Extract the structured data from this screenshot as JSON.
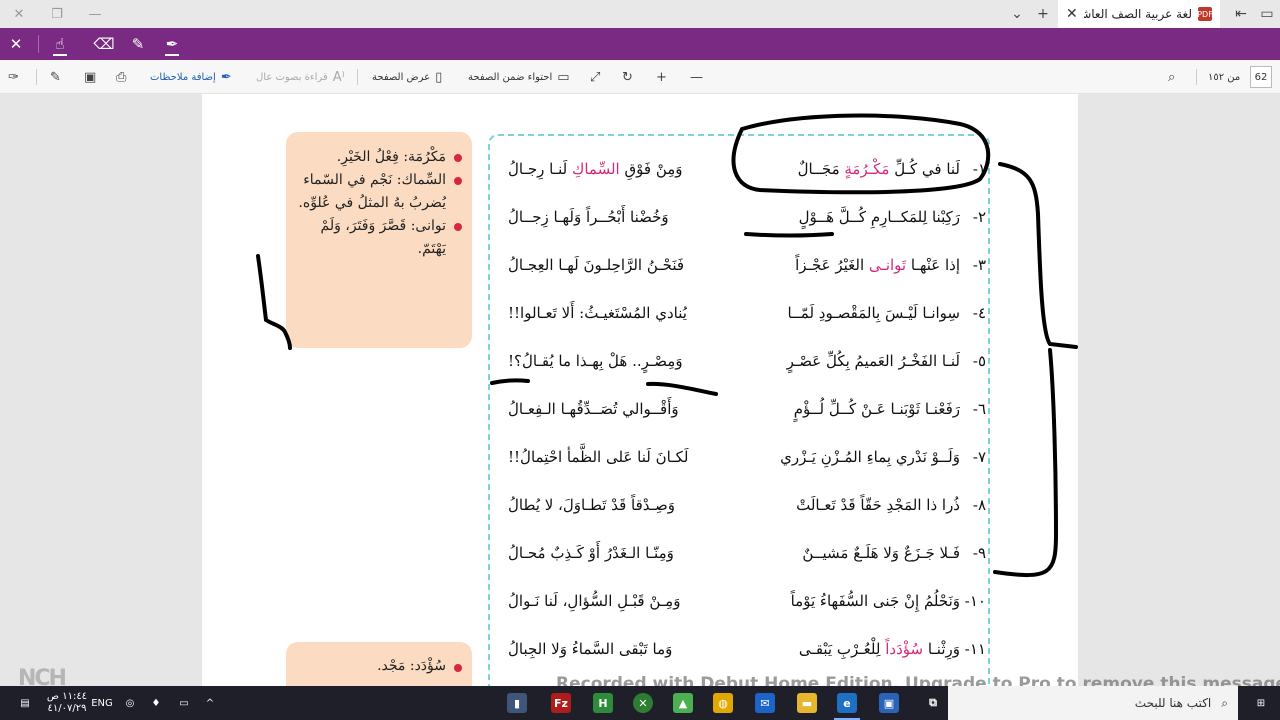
{
  "browser": {
    "tab_title": "لغة عربية الصف العاشر ا",
    "tab_badge": "PDF"
  },
  "reading_toolbar": {
    "page_number": "62",
    "page_total": "من ١٥٢",
    "fit_page": "احتواء ضمن الصفحة",
    "page_view": "عرض الصفحة",
    "read_aloud": "قراءة بصوت عال",
    "add_notes": "إضافة ملاحظات"
  },
  "poem": {
    "verses": [
      {
        "num": "١-",
        "h1_a": "لَنا في كُـلِّ ",
        "h1_pink": "مَكْـرُمَةٍ",
        "h1_b": " مَجَــالٌ",
        "h2_a": "وَمِنْ فَوْقِ ",
        "h2_pink": "السِّماكِ",
        "h2_b": " لَنـا رِجـالُ"
      },
      {
        "num": "٢-",
        "h1_a": "رَكِبْنا لِلمَكــارِمِ كُــلَّ هَــوْلٍ",
        "h1_pink": "",
        "h1_b": "",
        "h2_a": "وَخُضْنا أَبْحُــراً وَلَهـا زِجــالُ",
        "h2_pink": "",
        "h2_b": ""
      },
      {
        "num": "٣-",
        "h1_a": "إذا عَنْهـا ",
        "h1_pink": "تَوانـى",
        "h1_b": " الغَيْرُ عَجْـزاً",
        "h2_a": "فَنَحْـنُ الرَّاحِلـونَ لَهـا العِجـالُ",
        "h2_pink": "",
        "h2_b": ""
      },
      {
        "num": "٤-",
        "h1_a": "سِوانـا لَيْـسَ بِالمَقْصـودِ لَمّــا",
        "h1_pink": "",
        "h1_b": "",
        "h2_a": "يُنادي المُسْتَغيـثُ: أَلا تَعـالوا!!",
        "h2_pink": "",
        "h2_b": ""
      },
      {
        "num": "٥-",
        "h1_a": "لَنـا الفَخْـرُ العَميمُ بِكُلِّ عَصْـرٍ",
        "h1_pink": "",
        "h1_b": "",
        "h2_a": "وَمِصْـرٍ.. هَلْ بِهـذا ما يُقـالُ؟!",
        "h2_pink": "",
        "h2_b": ""
      },
      {
        "num": "٦-",
        "h1_a": "رَفَعْنـا ثَوْبَنـا عَـنْ كُــلِّ لُــؤْمٍ",
        "h1_pink": "",
        "h1_b": "",
        "h2_a": "وَأَقْــوالي تُصَــدِّقُهـا الـفِعـالُ",
        "h2_pink": "",
        "h2_b": ""
      },
      {
        "num": "٧-",
        "h1_a": "وَلَــوْ نَدْري بِماءِ المُـزْنِ يَـزْري",
        "h1_pink": "",
        "h1_b": "",
        "h2_a": "لَكـانَ لَنا عَلى الظَّمأ احْتِمالُ!!",
        "h2_pink": "",
        "h2_b": ""
      },
      {
        "num": "٨-",
        "h1_a": "ذُرا ذا المَجْدِ حَقّاً قَدْ تَعـالَتْ",
        "h1_pink": "",
        "h1_b": "",
        "h2_a": "وَصِـدْقاً قَدْ تَطـاوَلَ، لا يُطالُ",
        "h2_pink": "",
        "h2_b": ""
      },
      {
        "num": "٩-",
        "h1_a": "فَـلا جَـزَعٌ وَلا هَلَـعٌ مَشيــنٌ",
        "h1_pink": "",
        "h1_b": "",
        "h2_a": "وَمِنّـا الـغَدْرُ أَوْ كَـذِبٌ مُحـالُ",
        "h2_pink": "",
        "h2_b": ""
      },
      {
        "num": "١٠-",
        "h1_a": "وَنَحْلُمُ إِنْ جَنى السُّفَهاءُ يَوْماً",
        "h1_pink": "",
        "h1_b": "",
        "h2_a": "وَمِـنْ قَبْـلِ السُّؤالِ، لَنا نَـوالُ",
        "h2_pink": "",
        "h2_b": ""
      },
      {
        "num": "١١-",
        "h1_a": "وَرِثْنـا ",
        "h1_pink": "سُؤْدَداً",
        "h1_b": " لِلْعُـرْبِ يَبْقـى",
        "h2_a": "وَما تَبْقى السَّماءُ وَلا الجِبالُ",
        "h2_pink": "",
        "h2_b": ""
      }
    ]
  },
  "glossary": {
    "box1": [
      "مَكْرُمَة: فِعْلُ الخَيْرِ.",
      "السِّماك: نَجْم في السّماء يُضربُ بهُ المثلُ في عُلوِّه.",
      "توانى: قَصَّرَ وَفَتَرَ، وَلَمْ يَهْتَمّ."
    ],
    "box2": [
      "سُؤْدَد: مَجْد."
    ]
  },
  "watermark": "Recorded with Debut Home Edition. Upgrade to Pro to remove this message",
  "watermark_logo": "NCH",
  "taskbar": {
    "search_placeholder": "اكتب هنا للبحث",
    "lang": "ENG",
    "time": "١١:٤٤ ص",
    "date": "٤١/٠٧/٢٩"
  }
}
